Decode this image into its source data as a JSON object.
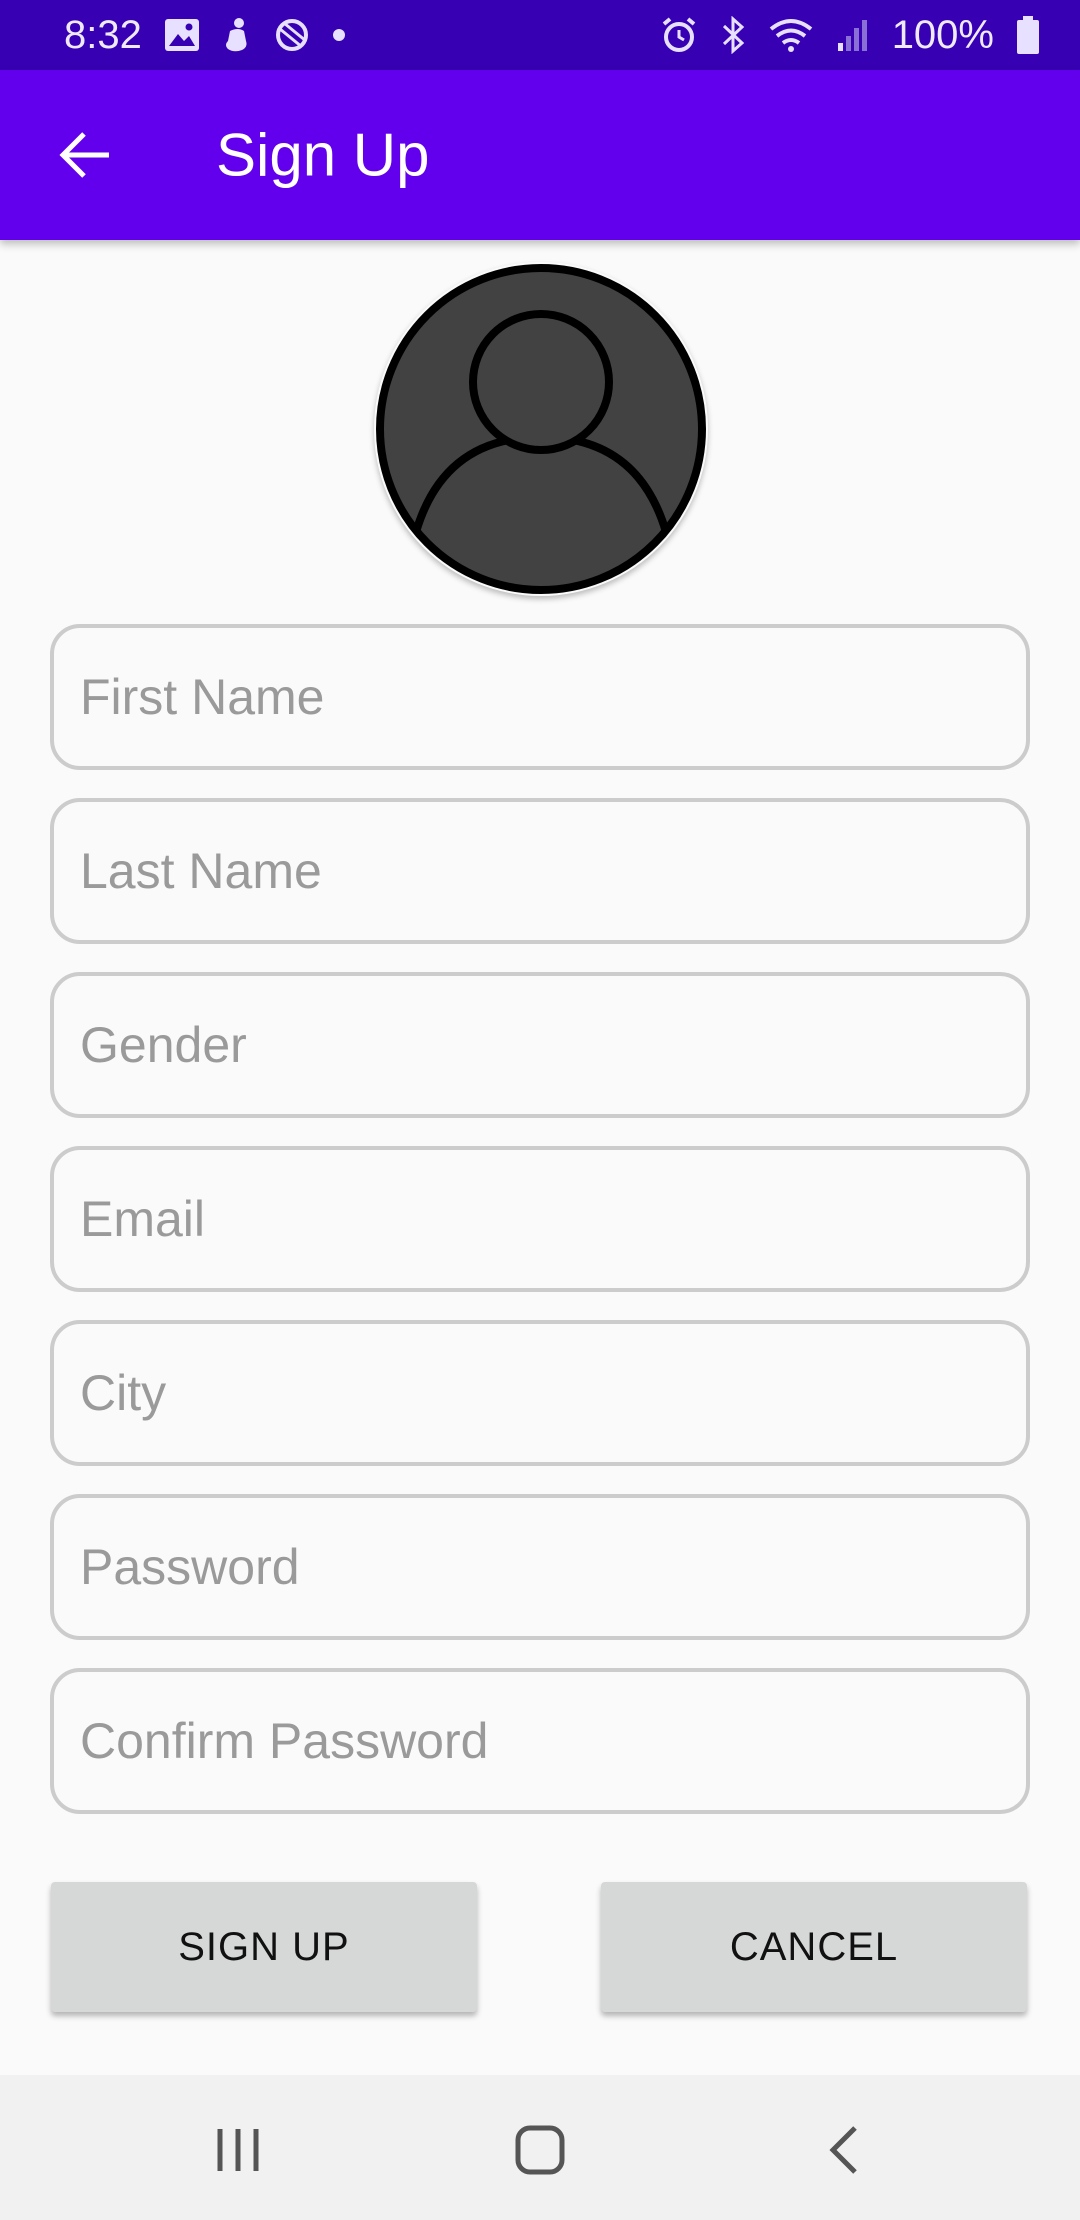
{
  "status_bar": {
    "time": "8:32",
    "battery_percent": "100%",
    "left_icons": [
      "image-icon",
      "notification-figure-icon",
      "sync-icon",
      "dot-icon"
    ],
    "right_icons": [
      "alarm-icon",
      "bluetooth-icon",
      "wifi-icon",
      "signal-icon",
      "battery-icon"
    ]
  },
  "app_bar": {
    "title": "Sign Up",
    "back_icon": "arrow-left-icon",
    "background": "#6200ee",
    "status_background": "#3700b3"
  },
  "avatar": {
    "icon": "user-profile-icon",
    "fill": "#424242"
  },
  "form": {
    "fields": [
      {
        "name": "first-name",
        "placeholder": "First Name",
        "value": ""
      },
      {
        "name": "last-name",
        "placeholder": "Last Name",
        "value": ""
      },
      {
        "name": "gender",
        "placeholder": "Gender",
        "value": ""
      },
      {
        "name": "email",
        "placeholder": "Email",
        "value": ""
      },
      {
        "name": "city",
        "placeholder": "City",
        "value": ""
      },
      {
        "name": "password",
        "placeholder": "Password",
        "value": ""
      },
      {
        "name": "confirm-password",
        "placeholder": "Confirm Password",
        "value": ""
      }
    ]
  },
  "buttons": {
    "sign_up": "SIGN UP",
    "cancel": "CANCEL"
  },
  "nav_bar": {
    "icons": [
      "recents-icon",
      "home-icon",
      "back-icon"
    ]
  }
}
